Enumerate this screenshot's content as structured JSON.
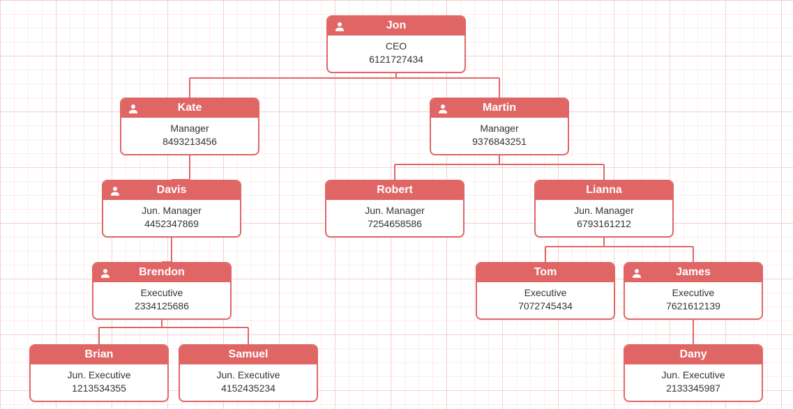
{
  "colors": {
    "accent": "#e06666",
    "grid_minor": "rgba(225,120,120,.12)",
    "grid_major": "rgba(225,120,120,.25)"
  },
  "nodes": {
    "jon": {
      "name": "Jon",
      "title": "CEO",
      "phone": "6121727434",
      "has_icon": true
    },
    "kate": {
      "name": "Kate",
      "title": "Manager",
      "phone": "8493213456",
      "has_icon": true
    },
    "martin": {
      "name": "Martin",
      "title": "Manager",
      "phone": "9376843251",
      "has_icon": true
    },
    "davis": {
      "name": "Davis",
      "title": "Jun. Manager",
      "phone": "4452347869",
      "has_icon": true
    },
    "robert": {
      "name": "Robert",
      "title": "Jun. Manager",
      "phone": "7254658586",
      "has_icon": false
    },
    "lianna": {
      "name": "Lianna",
      "title": "Jun. Manager",
      "phone": "6793161212",
      "has_icon": false
    },
    "brendon": {
      "name": "Brendon",
      "title": "Executive",
      "phone": "2334125686",
      "has_icon": true
    },
    "tom": {
      "name": "Tom",
      "title": "Executive",
      "phone": "7072745434",
      "has_icon": false
    },
    "james": {
      "name": "James",
      "title": "Executive",
      "phone": "7621612139",
      "has_icon": true
    },
    "brian": {
      "name": "Brian",
      "title": "Jun. Executive",
      "phone": "1213534355",
      "has_icon": false
    },
    "samuel": {
      "name": "Samuel",
      "title": "Jun. Executive",
      "phone": "4152435234",
      "has_icon": false
    },
    "dany": {
      "name": "Dany",
      "title": "Jun. Executive",
      "phone": "2133345987",
      "has_icon": false
    }
  },
  "hierarchy": {
    "jon": [
      "kate",
      "martin"
    ],
    "kate": [
      "davis"
    ],
    "martin": [
      "robert",
      "lianna"
    ],
    "davis": [
      "brendon"
    ],
    "lianna": [
      "tom",
      "james"
    ],
    "brendon": [
      "brian",
      "samuel"
    ],
    "james": [
      "dany"
    ]
  }
}
